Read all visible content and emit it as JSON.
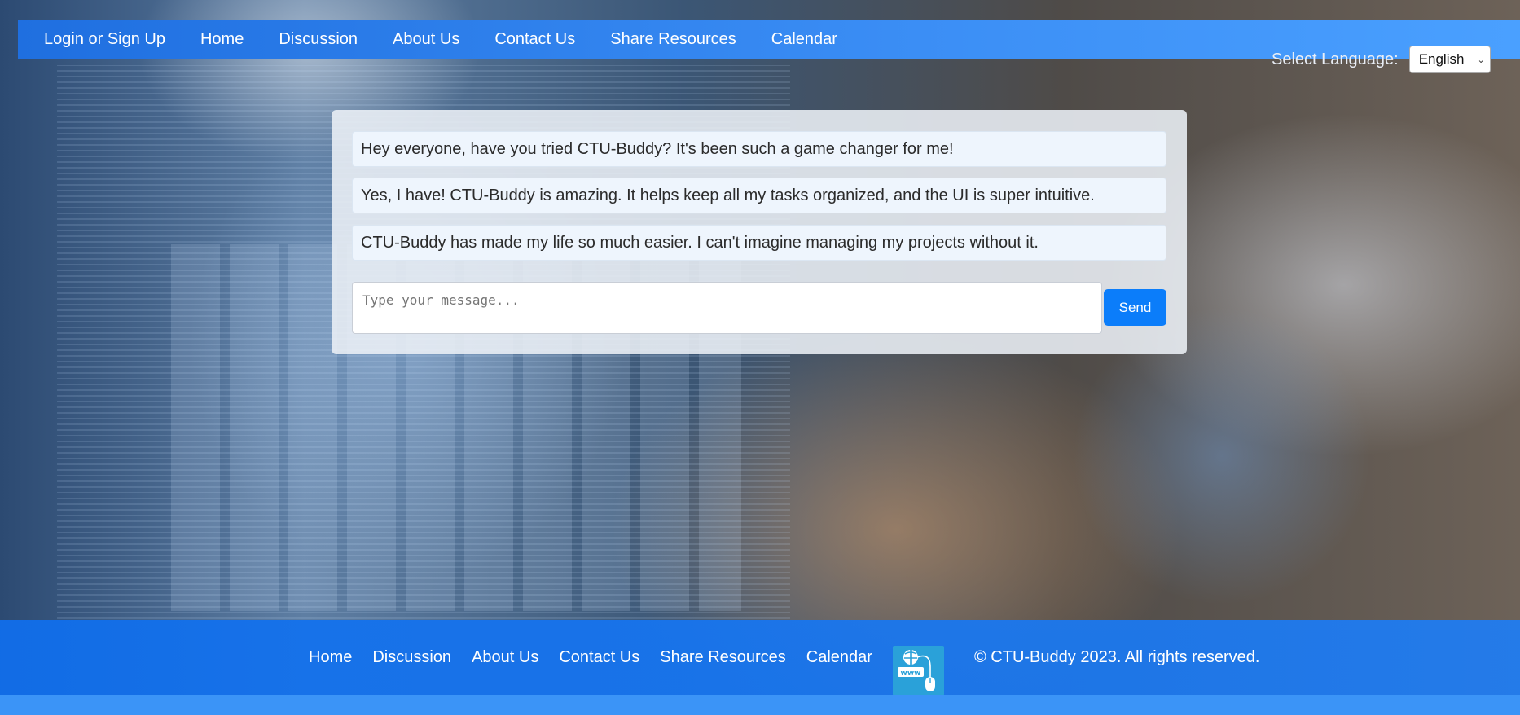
{
  "nav": {
    "items": [
      "Login or Sign Up",
      "Home",
      "Discussion",
      "About Us",
      "Contact Us",
      "Share Resources",
      "Calendar"
    ]
  },
  "language": {
    "label": "Select Language:",
    "selected": "English"
  },
  "chat": {
    "messages": [
      "Hey everyone, have you tried CTU-Buddy? It's been such a game changer for me!",
      "Yes, I have! CTU-Buddy is amazing. It helps keep all my tasks organized, and the UI is super intuitive.",
      "CTU-Buddy has made my life so much easier. I can't imagine managing my projects without it."
    ],
    "input_placeholder": "Type your message...",
    "send_label": "Send"
  },
  "footer": {
    "links": [
      "Home",
      "Discussion",
      "About Us",
      "Contact Us",
      "Share Resources",
      "Calendar"
    ],
    "logo_icon": "www-globe-mouse-icon",
    "copyright": "© CTU-Buddy 2023. All rights reserved."
  },
  "colors": {
    "nav_blue": "#2a82f0",
    "send_button": "#0b7dfa",
    "footer_blue": "#1670eb"
  }
}
